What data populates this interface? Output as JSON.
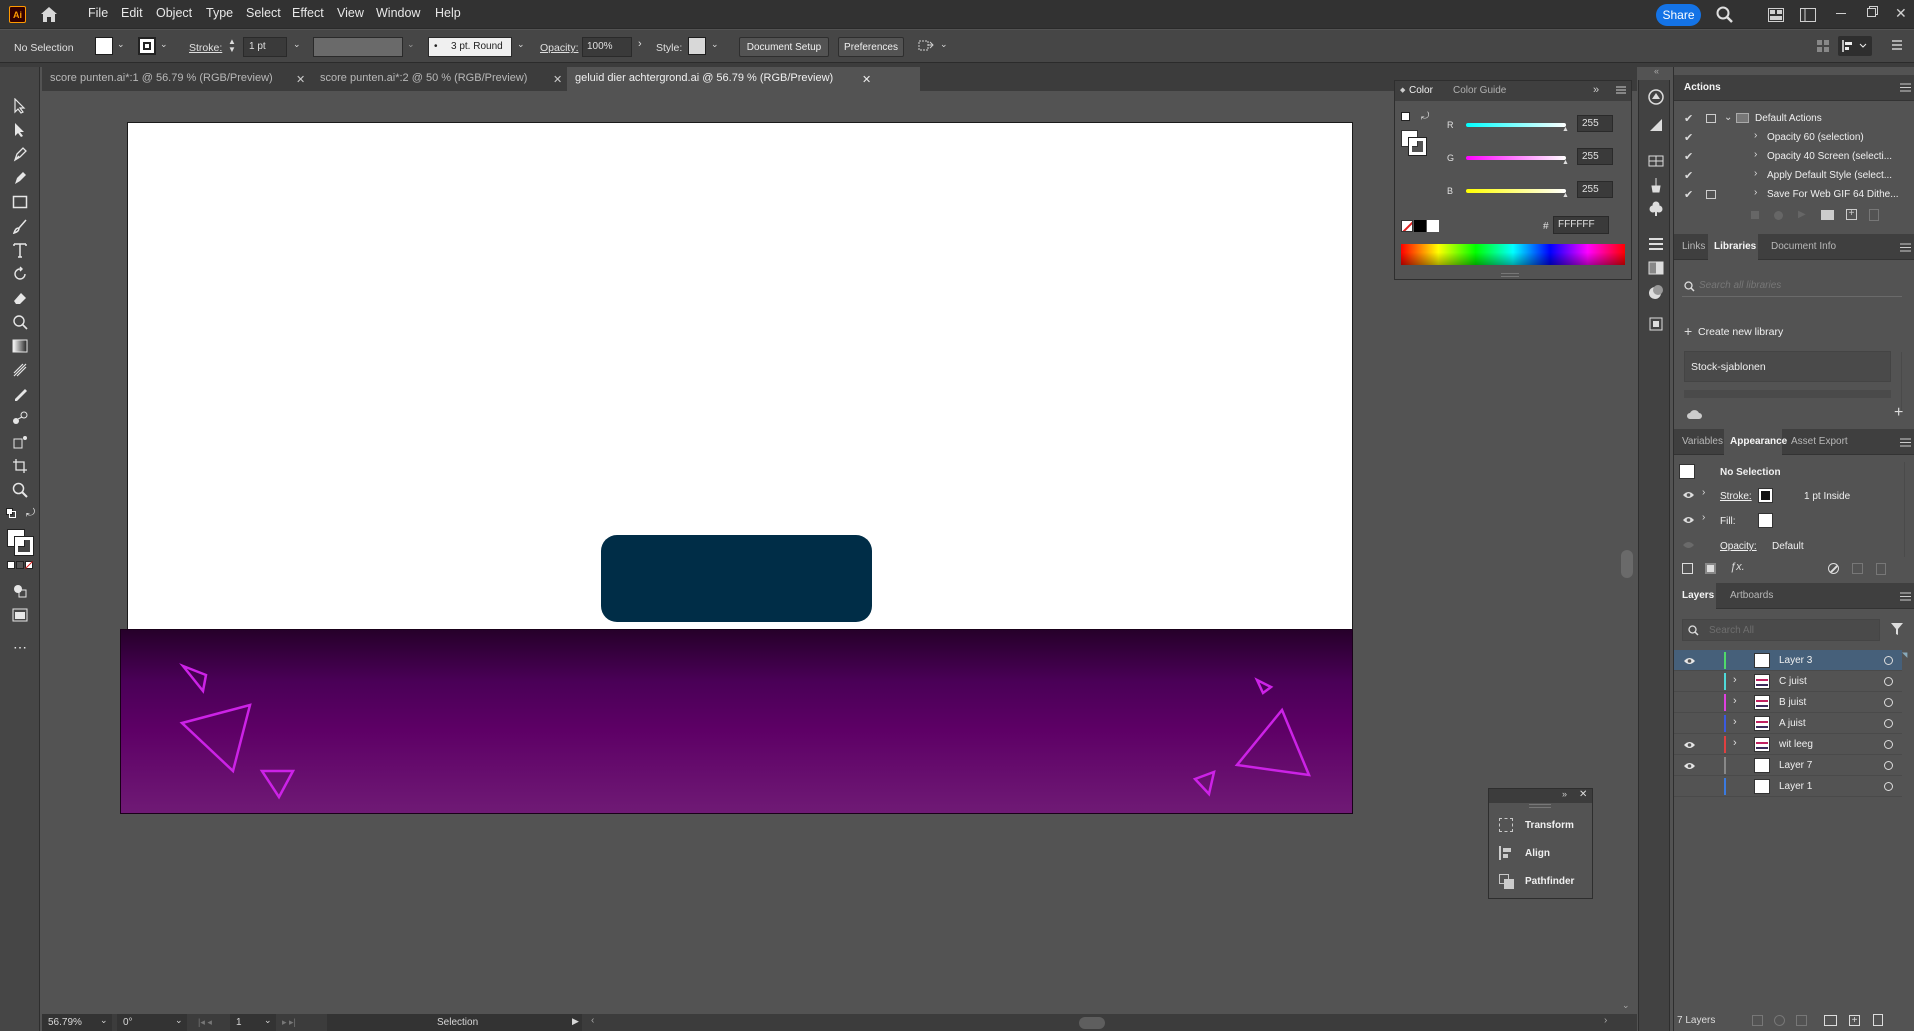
{
  "app": {
    "logo_text": "Ai",
    "share_label": "Share"
  },
  "menu": [
    "File",
    "Edit",
    "Object",
    "Type",
    "Select",
    "Effect",
    "View",
    "Window",
    "Help"
  ],
  "control": {
    "selection_label": "No Selection",
    "stroke_label": "Stroke:",
    "stroke_value": "1 pt",
    "brush_label": "3 pt. Round",
    "opacity_label": "Opacity:",
    "opacity_value": "100%",
    "style_label": "Style:",
    "document_setup": "Document Setup",
    "preferences": "Preferences"
  },
  "tabs": [
    {
      "label": "score punten.ai*:1 @ 56.79 % (RGB/Preview)"
    },
    {
      "label": "score punten.ai*:2 @ 50 % (RGB/Preview)"
    },
    {
      "label": "geluid dier achtergrond.ai @ 56.79 % (RGB/Preview)",
      "active": true
    }
  ],
  "status": {
    "zoom": "56.79%",
    "rotation": "0°",
    "artboard": "1",
    "tool": "Selection"
  },
  "color_panel": {
    "tabs": [
      "Color",
      "Color Guide"
    ],
    "r_label": "R",
    "g_label": "G",
    "b_label": "B",
    "r": "255",
    "g": "255",
    "b": "255",
    "hex_prefix": "#",
    "hex": "FFFFFF"
  },
  "actions_panel": {
    "title": "Actions",
    "items": [
      "Default Actions",
      "Opacity 60 (selection)",
      "Opacity 40 Screen (selecti...",
      "Apply Default Style (select...",
      "Save For Web GIF 64 Dithe..."
    ]
  },
  "libraries_panel": {
    "tabs": [
      "Links",
      "Libraries",
      "Document Info"
    ],
    "search_placeholder": "Search all libraries",
    "create_label": "Create new library",
    "library_item": "Stock-sjablonen"
  },
  "appearance_panel": {
    "tabs": [
      "Variables",
      "Appearance",
      "Asset Export"
    ],
    "selection": "No Selection",
    "stroke_label": "Stroke:",
    "stroke_value": "1 pt  Inside",
    "fill_label": "Fill:",
    "opacity_label": "Opacity:",
    "opacity_value": "Default"
  },
  "layers_panel": {
    "tabs": [
      "Layers",
      "Artboards"
    ],
    "search_placeholder": "Search All",
    "layers": [
      {
        "name": "Layer 3",
        "color": "#4fd96a",
        "visible": true,
        "selected": true
      },
      {
        "name": "C juist",
        "color": "#4fdada",
        "visible": false
      },
      {
        "name": "B juist",
        "color": "#e040e0",
        "visible": false
      },
      {
        "name": "A juist",
        "color": "#3a5ae0",
        "visible": false
      },
      {
        "name": "wit leeg",
        "color": "#e04040",
        "visible": true
      },
      {
        "name": "Layer 7",
        "color": "#888888",
        "visible": true
      },
      {
        "name": "Layer 1",
        "color": "#3a7ae0",
        "visible": false
      }
    ],
    "count": "7 Layers"
  },
  "float_panel": {
    "items": [
      "Transform",
      "Align",
      "Pathfinder"
    ]
  },
  "colors": {
    "artboard_bg": "#ffffff",
    "dark_rect": "#002d47",
    "triangle_stroke": "#cc22e6",
    "accent": "#1473e6"
  }
}
